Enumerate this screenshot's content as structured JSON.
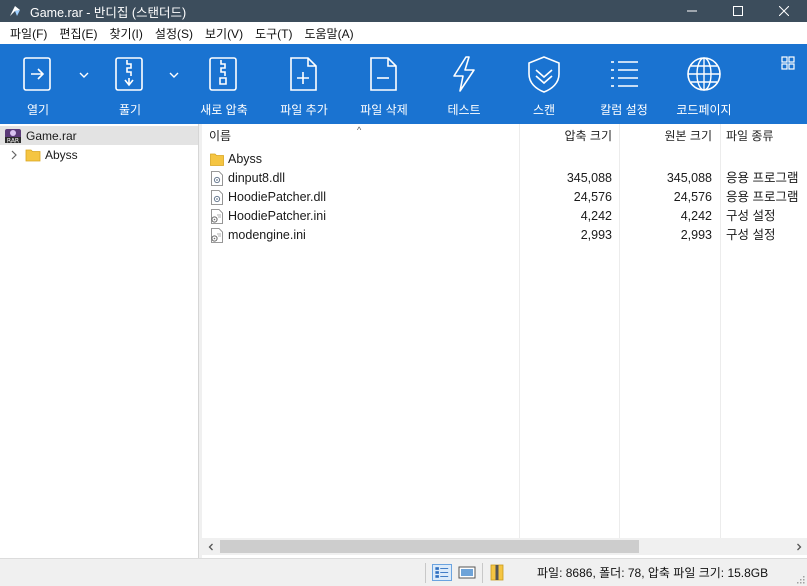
{
  "window": {
    "title": "Game.rar - 반디집 (스탠더드)",
    "controls": [
      "minimize",
      "maximize",
      "close"
    ]
  },
  "menu": [
    "파일(F)",
    "편집(E)",
    "찾기(I)",
    "설정(S)",
    "보기(V)",
    "도구(T)",
    "도움말(A)"
  ],
  "toolbar": {
    "buttons": [
      {
        "label": "열기",
        "icon": "open-icon",
        "has_dropdown": true
      },
      {
        "label": "풀기",
        "icon": "extract-icon",
        "has_dropdown": true
      },
      {
        "label": "새로 압축",
        "icon": "new-archive-icon"
      },
      {
        "label": "파일 추가",
        "icon": "add-file-icon"
      },
      {
        "label": "파일 삭제",
        "icon": "delete-file-icon"
      },
      {
        "label": "테스트",
        "icon": "test-icon"
      },
      {
        "label": "스캔",
        "icon": "scan-icon"
      },
      {
        "label": "칼럼 설정",
        "icon": "column-settings-icon"
      },
      {
        "label": "코드페이지",
        "icon": "codepage-icon"
      }
    ],
    "view_icon": "layout-grid-icon"
  },
  "tree": {
    "root": "Game.rar",
    "children": [
      "Abyss"
    ]
  },
  "list": {
    "columns": {
      "name": "이름",
      "packed": "압축 크기",
      "original": "원본 크기",
      "type": "파일 종류"
    },
    "sort_indicator": "^",
    "rows": [
      {
        "name": "Abyss",
        "icon": "folder-icon",
        "packed": "",
        "original": "",
        "type": ""
      },
      {
        "name": "dinput8.dll",
        "icon": "dll-file-icon",
        "packed": "345,088",
        "original": "345,088",
        "type": "응용 프로그램"
      },
      {
        "name": "HoodiePatcher.dll",
        "icon": "dll-file-icon",
        "packed": "24,576",
        "original": "24,576",
        "type": "응용 프로그램"
      },
      {
        "name": "HoodiePatcher.ini",
        "icon": "ini-file-icon",
        "packed": "4,242",
        "original": "4,242",
        "type": "구성 설정"
      },
      {
        "name": "modengine.ini",
        "icon": "ini-file-icon",
        "packed": "2,993",
        "original": "2,993",
        "type": "구성 설정"
      }
    ]
  },
  "status": {
    "summary": "파일: 8686, 폴더: 78, 압축 파일 크기: 15.8GB"
  },
  "colors": {
    "titlebar": "#3c4d5c",
    "toolbar": "#1a73d1",
    "folder": "#f5c542"
  }
}
